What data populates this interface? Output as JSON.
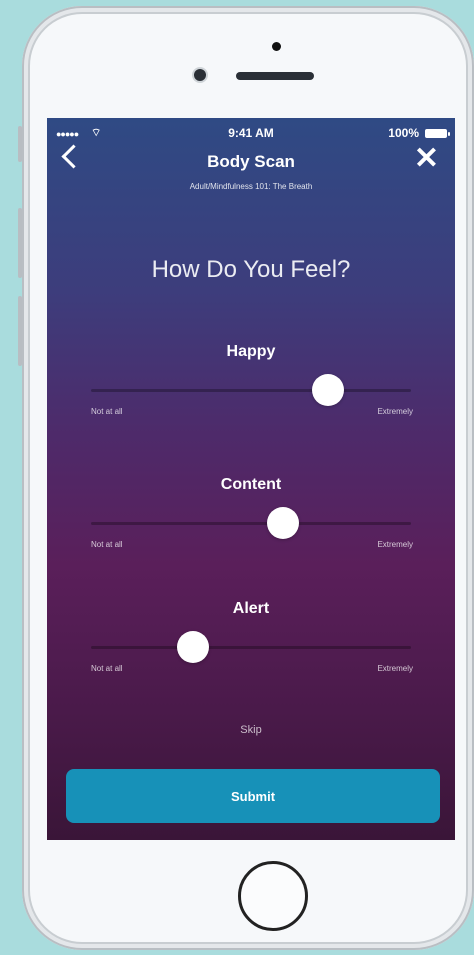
{
  "status_bar": {
    "signal": "●●●●●",
    "wifi": "⌔",
    "time": "9:41 AM",
    "battery": "100%"
  },
  "header": {
    "title": "Body Scan",
    "subtitle": "Adult/Mindfulness 101: The Breath",
    "back_icon": "chevron-left-icon",
    "close_icon": "close-icon",
    "close_glyph": "✕"
  },
  "question": "How Do You Feel?",
  "sliders": [
    {
      "label": "Happy",
      "value": 0.74,
      "min_label": "Not at all",
      "max_label": "Extremely"
    },
    {
      "label": "Content",
      "value": 0.6,
      "min_label": "Not at all",
      "max_label": "Extremely"
    },
    {
      "label": "Alert",
      "value": 0.32,
      "min_label": "Not at all",
      "max_label": "Extremely"
    }
  ],
  "skip_label": "Skip",
  "submit_label": "Submit",
  "colors": {
    "submit": "#1791b8",
    "gradient_top": "#2f4a84",
    "gradient_bottom": "#3a1538"
  }
}
